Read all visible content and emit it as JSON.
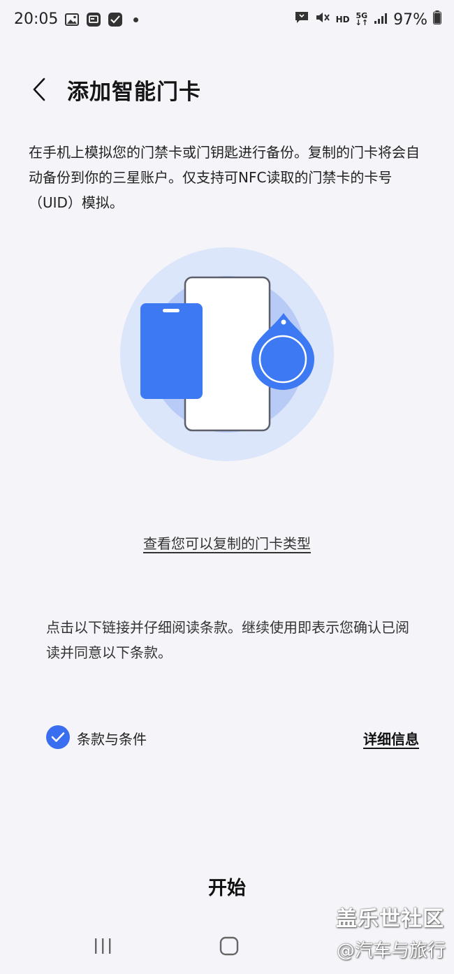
{
  "status_bar": {
    "time": "20:05",
    "left_icons": [
      "image-icon",
      "app-notification-icon",
      "check-badge-icon"
    ],
    "hd": "HD",
    "network": "5G",
    "battery_text": "97%",
    "battery_level": 0.97
  },
  "header": {
    "title": "添加智能门卡"
  },
  "description": "在手机上模拟您的门禁卡或门钥匙进行备份。复制的门卡将会自动备份到你的三星账户。仅支持可NFC读取的门禁卡的卡号（UID）模拟。",
  "types_link": "查看您可以复制的门卡类型",
  "terms_notice": "点击以下链接并仔细阅读条款。继续使用即表示您确认已阅读并同意以下条款。",
  "terms": {
    "checked": true,
    "label": "条款与条件",
    "details_link": "详细信息"
  },
  "start_button": "开始",
  "watermark": {
    "line1": "盖乐世社区",
    "line2": "@汽车与旅行"
  },
  "colors": {
    "accent": "#3a6ef0",
    "background": "#f5f5f9",
    "illustration_outer": "#dce6fb",
    "illustration_inner": "#b3c8f7",
    "card_blue": "#3d79f2"
  }
}
